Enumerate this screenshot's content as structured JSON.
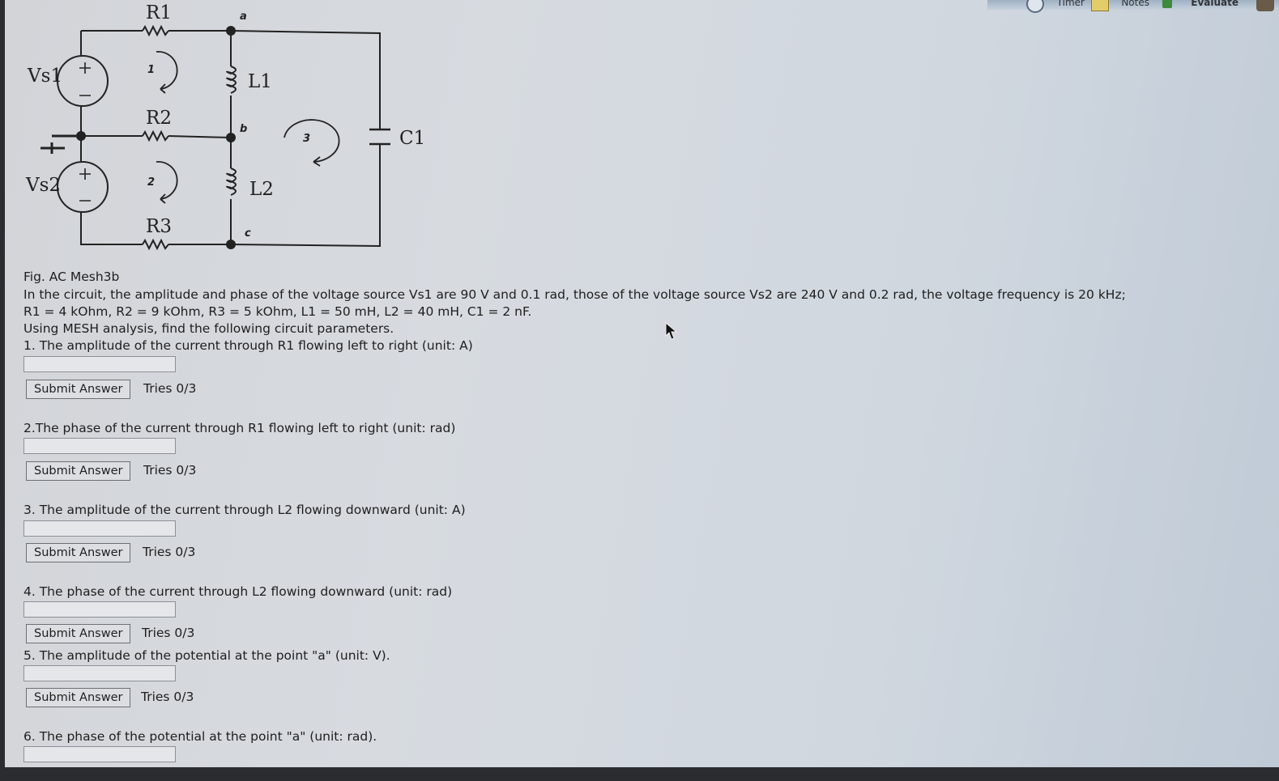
{
  "toolbar": {
    "timer_label": "Timer",
    "notes_label": "Notes",
    "evaluate_label": "Evaluate",
    "icons": [
      "timer-icon",
      "notes-icon",
      "evaluate-icon"
    ]
  },
  "circuit": {
    "resistors": [
      "R1",
      "R2",
      "R3"
    ],
    "inductors": [
      "L1",
      "L2"
    ],
    "capacitor": "C1",
    "sources": [
      "Vs1",
      "Vs2"
    ],
    "nodes": [
      "a",
      "b",
      "c"
    ],
    "meshes": [
      "1",
      "2",
      "3"
    ]
  },
  "problem": {
    "figure_caption": "Fig. AC Mesh3b",
    "statement_1": "In the circuit, the amplitude and phase of the voltage source Vs1 are 90 V and 0.1 rad, those of the voltage source Vs2 are 240 V and 0.2 rad, the voltage frequency is 20 kHz;",
    "statement_2": "R1 = 4 kOhm, R2 = 9 kOhm, R3 = 5 kOhm, L1 = 50 mH, L2 = 40 mH, C1 = 2 nF.",
    "instruction": "Using MESH analysis, find the following circuit parameters."
  },
  "questions": [
    {
      "text": "1. The amplitude of the current through R1 flowing left to right (unit: A)",
      "input_value": "",
      "button": "Submit Answer",
      "tries": "Tries 0/3"
    },
    {
      "text": "2.The phase of the current through R1 flowing left to right (unit: rad)",
      "input_value": "",
      "button": "Submit Answer",
      "tries": "Tries 0/3"
    },
    {
      "text": "3. The amplitude of the current through L2 flowing downward (unit: A)",
      "input_value": "",
      "button": "Submit Answer",
      "tries": "Tries 0/3"
    },
    {
      "text": "4. The phase of the current through L2 flowing downward (unit: rad)",
      "input_value": "",
      "button": "Submit Answer",
      "tries": "Tries 0/3"
    },
    {
      "text": "5. The amplitude of the potential at the point \"a\" (unit: V).",
      "input_value": "",
      "button": "Submit Answer",
      "tries": "Tries 0/3"
    },
    {
      "text": "6. The phase of the potential at the point \"a\" (unit: rad).",
      "input_value": ""
    }
  ]
}
